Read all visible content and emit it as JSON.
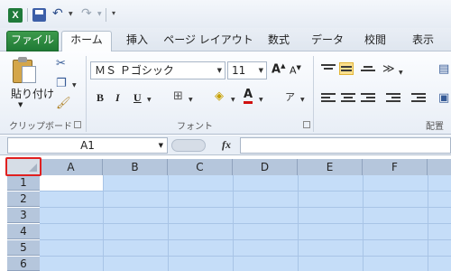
{
  "quick_access": {
    "app_icon": "excel-icon",
    "save_icon": "save-icon",
    "undo_icon": "undo-icon",
    "redo_icon": "redo-icon",
    "customize_icon": "customize-toolbar-icon"
  },
  "tabs": [
    {
      "label": "ファイル"
    },
    {
      "label": "ホーム"
    },
    {
      "label": "挿入"
    },
    {
      "label": "ページ レイアウト"
    },
    {
      "label": "数式"
    },
    {
      "label": "データ"
    },
    {
      "label": "校閲"
    },
    {
      "label": "表示"
    }
  ],
  "ribbon": {
    "clipboard": {
      "paste_label": "貼り付け",
      "group_label": "クリップボード"
    },
    "font": {
      "font_name": "ＭＳ Ｐゴシック",
      "font_size": "11",
      "bold": "B",
      "italic": "I",
      "underline": "U",
      "font_color_letter": "A",
      "group_label": "フォント"
    },
    "alignment": {
      "group_label": "配置"
    }
  },
  "formula_bar": {
    "name_box": "A1",
    "fx_label": "fx",
    "formula": ""
  },
  "grid": {
    "columns": [
      "A",
      "B",
      "C",
      "D",
      "E",
      "F"
    ],
    "rows": [
      "1",
      "2",
      "3",
      "4",
      "5",
      "6"
    ],
    "selection": "all"
  },
  "colors": {
    "file_tab": "#1f7a35",
    "selection_fill": "#c5ddf8",
    "corner_highlight": "#e02020"
  }
}
